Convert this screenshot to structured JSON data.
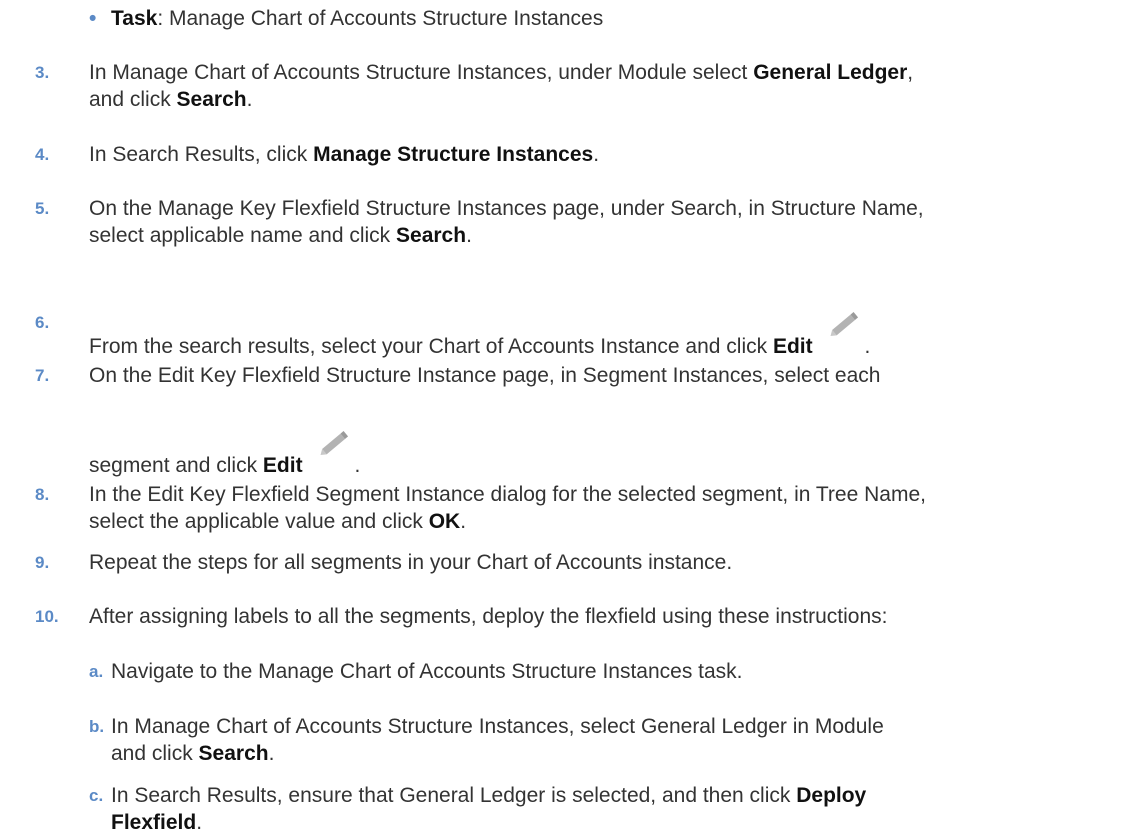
{
  "bullet": {
    "marker": "•",
    "label": "Task",
    "text": ": Manage Chart of Accounts Structure Instances"
  },
  "steps": [
    {
      "num": "3.",
      "t1": "In Manage Chart of Accounts Structure Instances, under Module select ",
      "b1": "General Ledger",
      "t2": ",",
      "t3": "and click ",
      "b2": "Search",
      "t4": "."
    },
    {
      "num": "4.",
      "t1": "In Search Results, click ",
      "b1": "Manage Structure Instances",
      "t2": "."
    },
    {
      "num": "5.",
      "t1": "On the Manage Key Flexfield Structure Instances page, under Search, in Structure Name,",
      "t2": "select applicable name and click ",
      "b1": "Search",
      "t3": "."
    },
    {
      "num": "6.",
      "t1": "From the search results, select your Chart of Accounts Instance and click ",
      "b1": "Edit",
      "t2": "."
    },
    {
      "num": "7.",
      "t1": "On the Edit Key Flexfield Structure Instance page, in Segment Instances, select each",
      "t2": "segment and click ",
      "b1": "Edit",
      "t3": "."
    },
    {
      "num": "8.",
      "t1": "In the Edit Key Flexfield Segment Instance dialog for the selected segment, in Tree Name,",
      "t2": "select the applicable value and click ",
      "b1": "OK",
      "t3": "."
    },
    {
      "num": "9.",
      "t1": "Repeat the steps for all segments in your Chart of Accounts instance."
    },
    {
      "num": "10.",
      "t1": "After assigning labels to all the segments, deploy the flexfield using these instructions:"
    }
  ],
  "substeps": [
    {
      "num": "a.",
      "t1": "Navigate to the Manage Chart of Accounts Structure Instances task."
    },
    {
      "num": "b.",
      "t1": "In Manage Chart of Accounts Structure Instances, select General Ledger in Module",
      "t2": "and click ",
      "b1": "Search",
      "t3": "."
    },
    {
      "num": "c.",
      "t1": "In Search Results, ensure that General Ledger is selected, and then click ",
      "b1": "Deploy",
      "b2": "Flexfield",
      "t2": "."
    }
  ],
  "icons": {
    "edit": "pencil-icon"
  },
  "colors": {
    "step_number": "#5b8ac6",
    "text": "#333333"
  }
}
